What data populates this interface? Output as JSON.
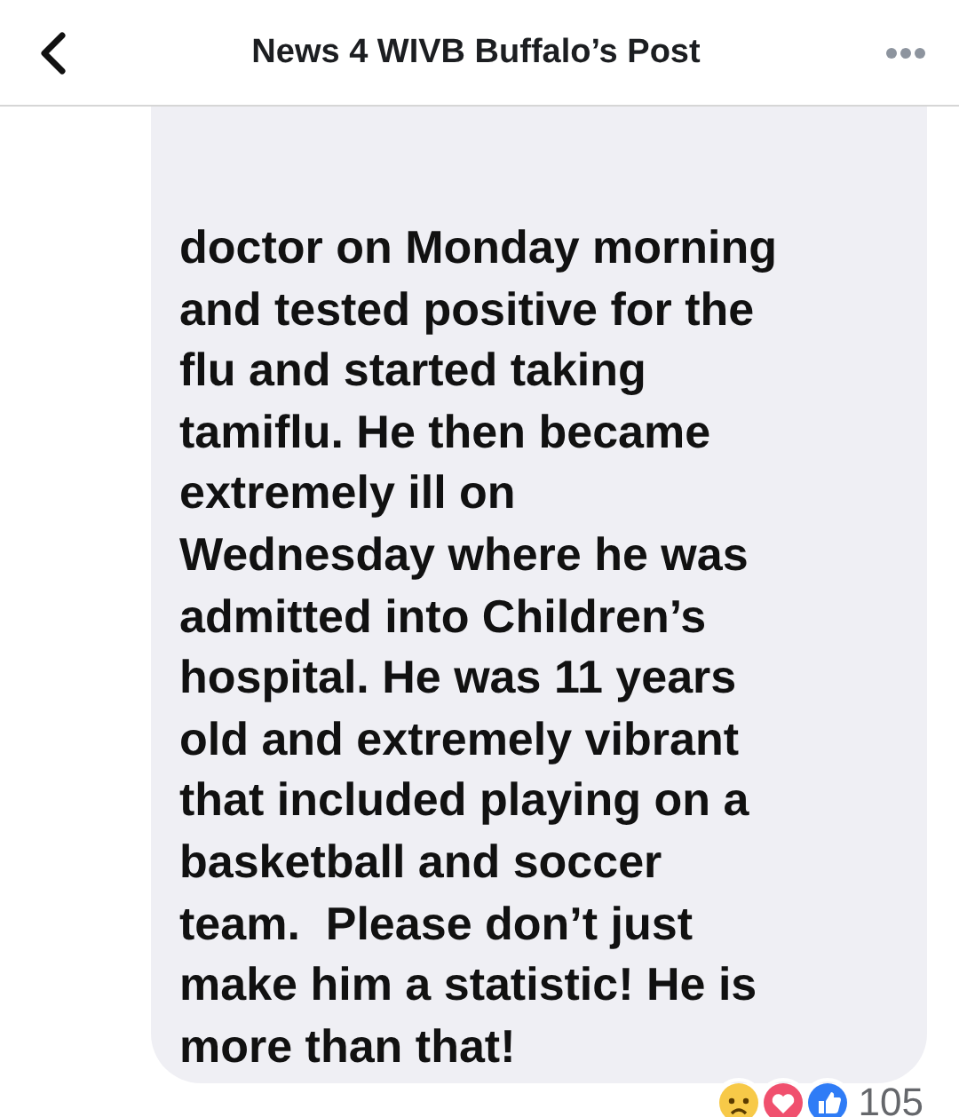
{
  "header": {
    "title": "News 4 WIVB Buffalo’s Post"
  },
  "comment": {
    "lines": [
      "doctor on Monday morning",
      "and tested positive for the",
      "flu and started taking",
      "tamiflu. He then became",
      "extremely ill on",
      "Wednesday where he was",
      "admitted into Children’s",
      "hospital. He was 11 years",
      "old and extremely vibrant",
      "that included playing on a",
      "basketball and soccer",
      "team.  Please don’t just",
      "make him a statistic! He is",
      "more than that!"
    ],
    "reactions": {
      "count": "105"
    }
  }
}
